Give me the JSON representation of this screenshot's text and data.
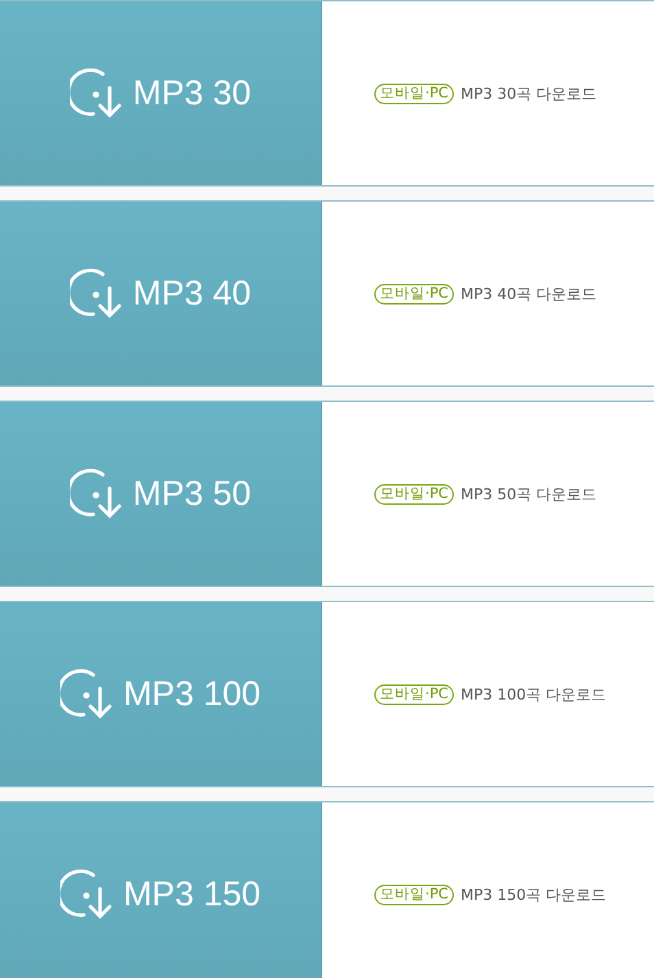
{
  "products": [
    {
      "title": "MP3 30",
      "badge": "모바일·PC",
      "description": "MP3 30곡 다운로드"
    },
    {
      "title": "MP3 40",
      "badge": "모바일·PC",
      "description": "MP3 40곡 다운로드"
    },
    {
      "title": "MP3 50",
      "badge": "모바일·PC",
      "description": "MP3 50곡 다운로드"
    },
    {
      "title": "MP3 100",
      "badge": "모바일·PC",
      "description": "MP3 100곡 다운로드"
    },
    {
      "title": "MP3 150",
      "badge": "모바일·PC",
      "description": "MP3 150곡 다운로드"
    }
  ]
}
